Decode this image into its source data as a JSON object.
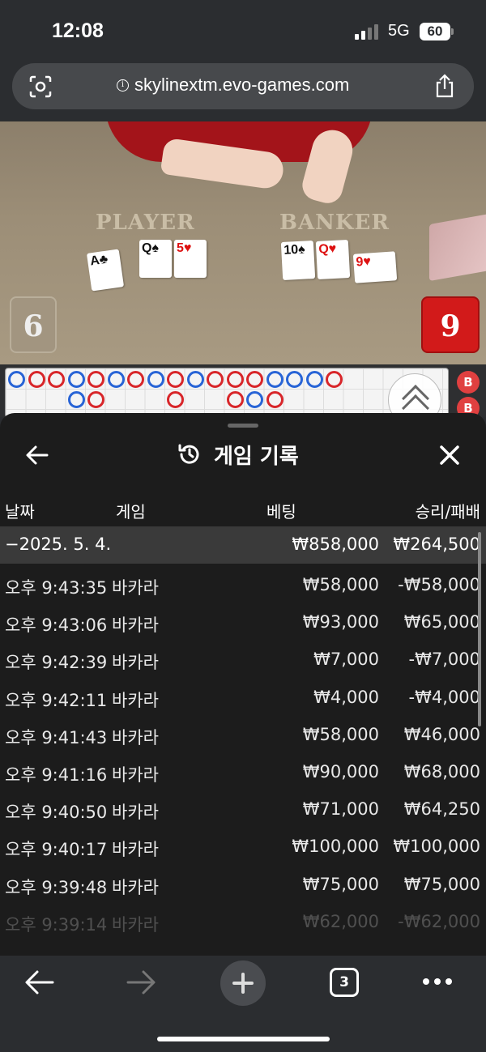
{
  "status_bar": {
    "time": "12:08",
    "network": "5G",
    "battery": "60"
  },
  "browser": {
    "url": "skylinextm.evo-games.com",
    "lens_icon": "camera-search-icon",
    "info_icon": "info-icon",
    "share_icon": "share-icon"
  },
  "game": {
    "player_label": "PLAYER",
    "banker_label": "BANKER",
    "player_cards": [
      {
        "rank": "A",
        "suit": "♣",
        "color": "black"
      },
      {
        "rank": "Q",
        "suit": "♠",
        "color": "black"
      },
      {
        "rank": "5",
        "suit": "♥",
        "color": "red"
      }
    ],
    "banker_cards": [
      {
        "rank": "10",
        "suit": "♠",
        "color": "black"
      },
      {
        "rank": "Q",
        "suit": "♥",
        "color": "red"
      },
      {
        "rank": "9",
        "suit": "♥",
        "color": "red"
      }
    ],
    "player_score": "6",
    "banker_score": "9",
    "road_badges": [
      "B",
      "B"
    ]
  },
  "history": {
    "title": "게임 기록",
    "back_icon": "back-arrow-icon",
    "title_icon": "history-icon",
    "close_icon": "close-icon",
    "columns": {
      "date": "날짜",
      "game": "게임",
      "bet": "베팅",
      "win": "승리/패배"
    },
    "summary": {
      "date": "−2025. 5. 4.",
      "bet": "₩858,000",
      "win": "₩264,500"
    },
    "rows": [
      {
        "time": "오후 9:43:35",
        "game": "바카라",
        "bet": "₩58,000",
        "win": "-₩58,000"
      },
      {
        "time": "오후 9:43:06",
        "game": "바카라",
        "bet": "₩93,000",
        "win": "₩65,000"
      },
      {
        "time": "오후 9:42:39",
        "game": "바카라",
        "bet": "₩7,000",
        "win": "-₩7,000"
      },
      {
        "time": "오후 9:42:11",
        "game": "바카라",
        "bet": "₩4,000",
        "win": "-₩4,000"
      },
      {
        "time": "오후 9:41:43",
        "game": "바카라",
        "bet": "₩58,000",
        "win": "₩46,000"
      },
      {
        "time": "오후 9:41:16",
        "game": "바카라",
        "bet": "₩90,000",
        "win": "₩68,000"
      },
      {
        "time": "오후 9:40:50",
        "game": "바카라",
        "bet": "₩71,000",
        "win": "₩64,250"
      },
      {
        "time": "오후 9:40:17",
        "game": "바카라",
        "bet": "₩100,000",
        "win": "₩100,000"
      },
      {
        "time": "오후 9:39:48",
        "game": "바카라",
        "bet": "₩75,000",
        "win": "₩75,000"
      },
      {
        "time": "오후 9:39:14",
        "game": "바카라",
        "bet": "₩62,000",
        "win": "-₩62,000"
      }
    ]
  },
  "toolbar": {
    "tab_count": "3"
  }
}
